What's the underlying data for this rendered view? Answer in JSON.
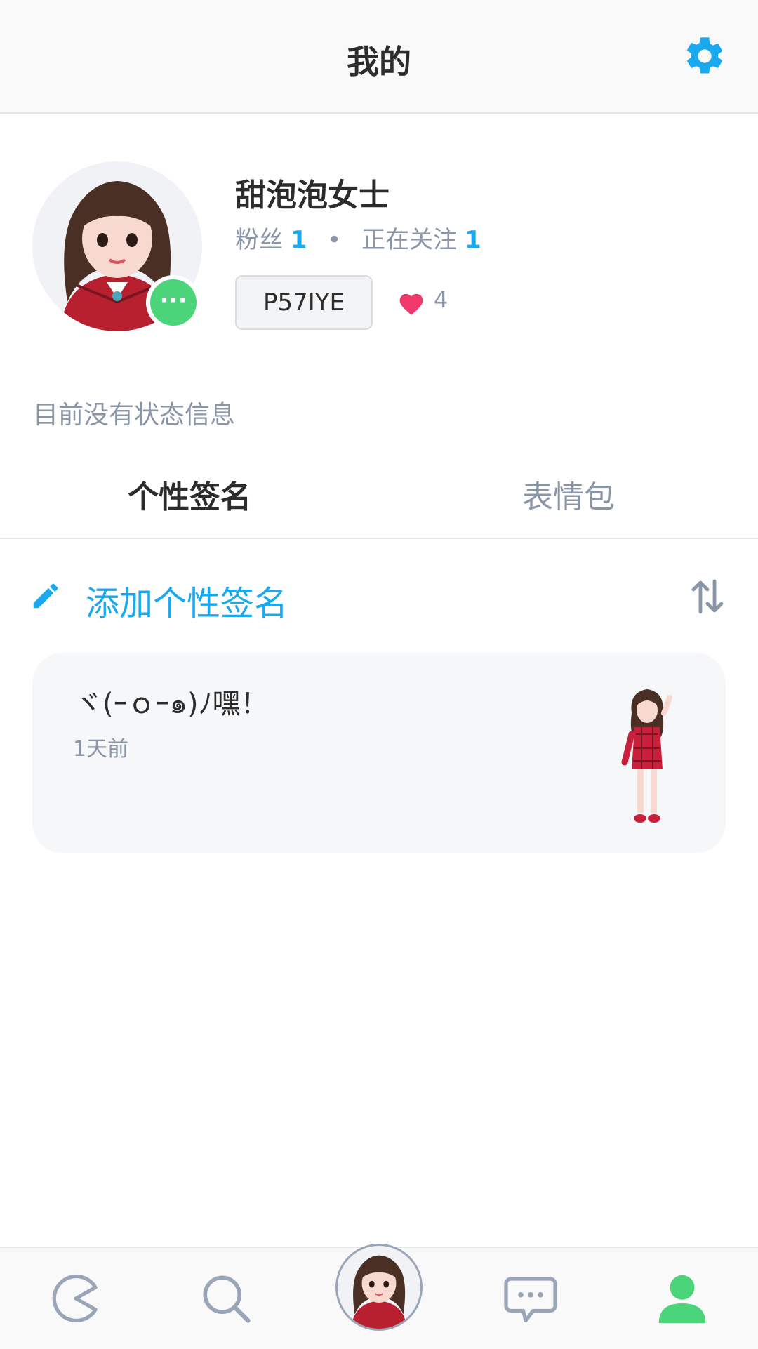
{
  "header": {
    "title": "我的",
    "settings_icon": "gear-icon"
  },
  "profile": {
    "username": "甜泡泡女士",
    "fans_label": "粉丝",
    "fans_count": "1",
    "following_label": "正在关注",
    "following_count": "1",
    "user_code": "P57IYE",
    "likes": "4",
    "status_badge": "···"
  },
  "status_text": "目前没有状态信息",
  "tabs": [
    {
      "label": "个性签名",
      "active": true
    },
    {
      "label": "表情包",
      "active": false
    }
  ],
  "add_signature": {
    "label": "添加个性签名"
  },
  "signatures": [
    {
      "text": "ヾ(ｰｏｰ๑)ﾉ嘿！",
      "time": "1天前"
    }
  ],
  "bottom_nav": [
    {
      "name": "feed",
      "icon": "pacman-icon"
    },
    {
      "name": "search",
      "icon": "search-icon"
    },
    {
      "name": "avatar",
      "icon": "avatar-icon"
    },
    {
      "name": "chat",
      "icon": "chat-bubble-icon"
    },
    {
      "name": "profile",
      "icon": "person-icon",
      "active": true
    }
  ],
  "colors": {
    "accent": "#1aa9ef",
    "green": "#4cd47a",
    "heart": "#f0386b",
    "muted": "#8a96a8"
  }
}
